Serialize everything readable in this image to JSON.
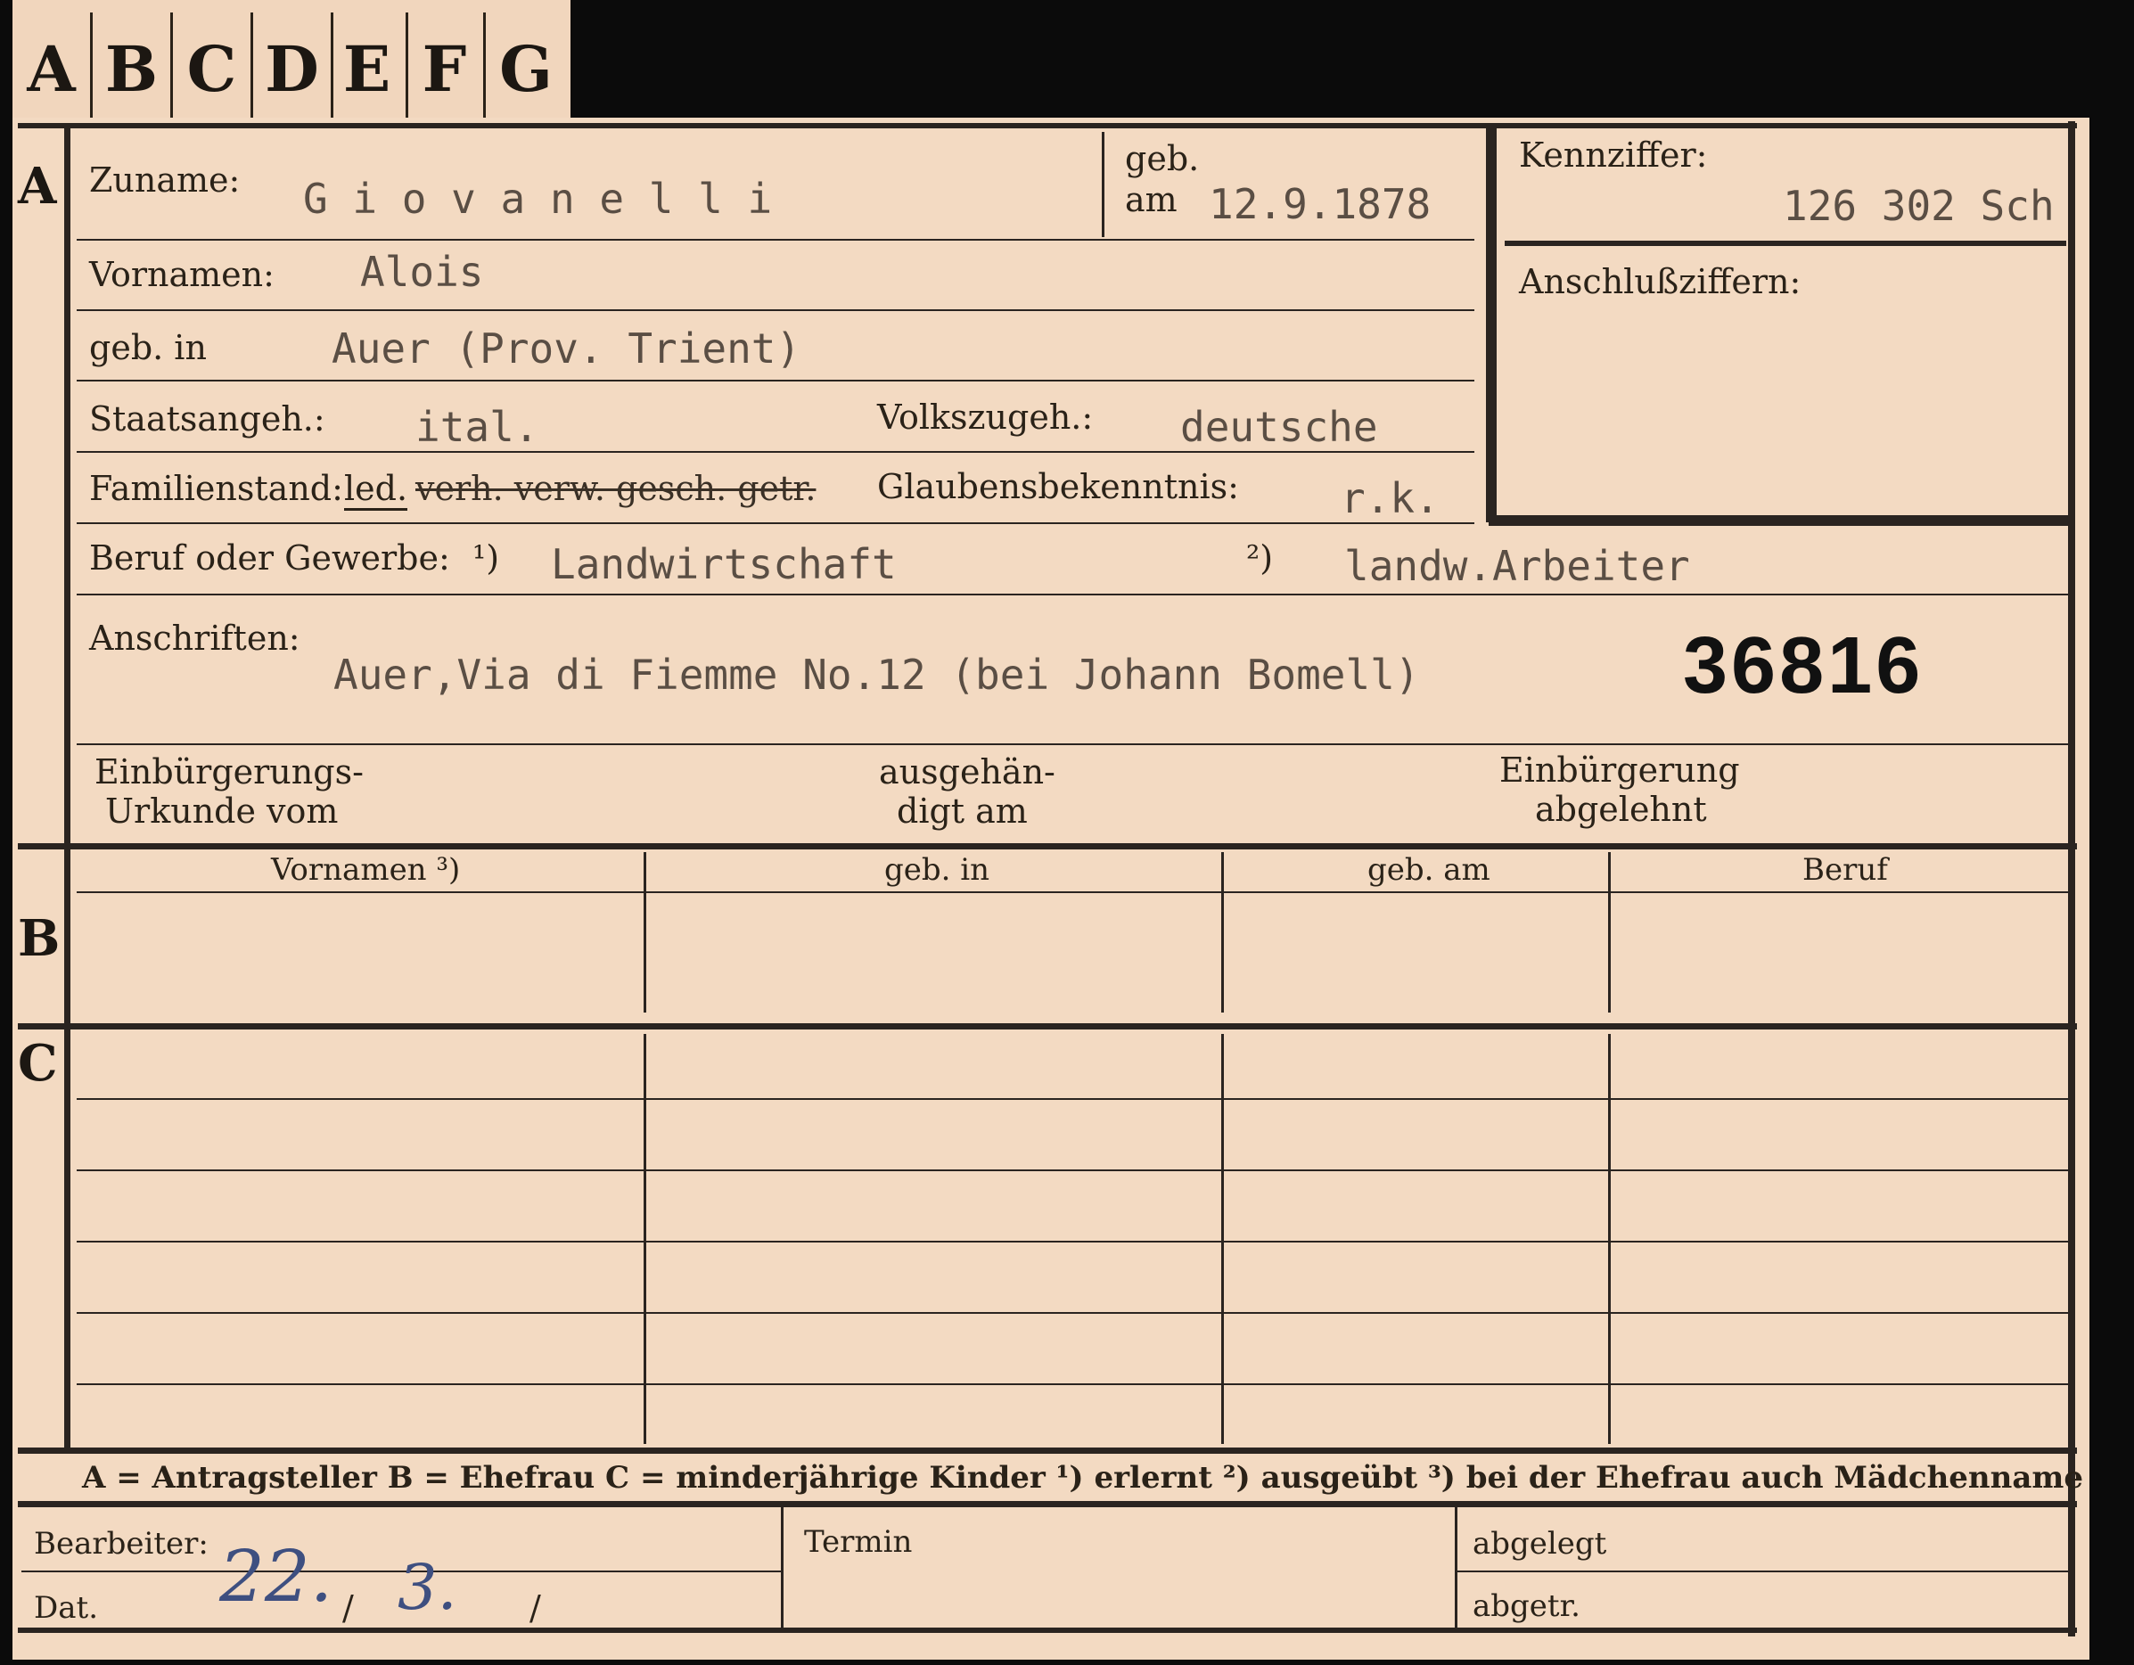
{
  "tabs": [
    "A",
    "B",
    "C",
    "D",
    "E",
    "F",
    "G"
  ],
  "section_a": {
    "marker": "A",
    "zuname_label": "Zuname:",
    "zuname_value": "G i o v a n e l l i",
    "geb_label_1": "geb.",
    "geb_label_2": "am",
    "geb_value": "12.9.1878",
    "vornamen_label": "Vornamen:",
    "vornamen_value": "Alois",
    "gebin_label": "geb. in",
    "gebin_value": "Auer (Prov. Trient)",
    "staats_label": "Staatsangeh.:",
    "staats_value": "ital.",
    "volks_label": "Volkszugeh.:",
    "volks_value": "deutsche",
    "familien_label": "Familienstand:",
    "familien_led": "led.",
    "familien_struck": "verh. verw. gesch. getr.",
    "glaubens_label": "Glaubensbekenntnis:",
    "glaubens_value": "r.k.",
    "beruf_label": "Beruf oder Gewerbe:",
    "beruf_fn1": "¹)",
    "beruf_value1": "Landwirtschaft",
    "beruf_fn2": "²)",
    "beruf_value2": "landw.Arbeiter",
    "anschrift_label": "Anschriften:",
    "anschrift_value": "Auer,Via di Fiemme No.12 (bei Johann Bomell)",
    "number": "36816",
    "einb_label_1": "Einbürgerungs-",
    "einb_label_2": "Urkunde vom",
    "ausgeh_label_1": "ausgehän-",
    "ausgeh_label_2": "digt am",
    "abgelehnt_label_1": "Einbürgerung",
    "abgelehnt_label_2": "abgelehnt"
  },
  "kennziffer": {
    "label": "Kennziffer:",
    "value": "126 302 Sch",
    "anschluss_label": "Anschlußziffern:"
  },
  "section_b": {
    "marker": "B",
    "columns": [
      "Vornamen ³)",
      "geb. in",
      "geb. am",
      "Beruf"
    ]
  },
  "section_c": {
    "marker": "C"
  },
  "legend": "A = Antragsteller   B = Ehefrau   C = minderjährige Kinder   ¹) erlernt   ²) ausgeübt   ³) bei der Ehefrau auch Mädchenname",
  "footer": {
    "bearbeiter_label": "Bearbeiter:",
    "dat_label": "Dat.",
    "dat_handwriting_1": "22.",
    "dat_handwriting_2": "3.",
    "dat_slash": "/",
    "termin_label": "Termin",
    "abgelegt_label": "abgelegt",
    "abgetr_label": "abgetr."
  }
}
